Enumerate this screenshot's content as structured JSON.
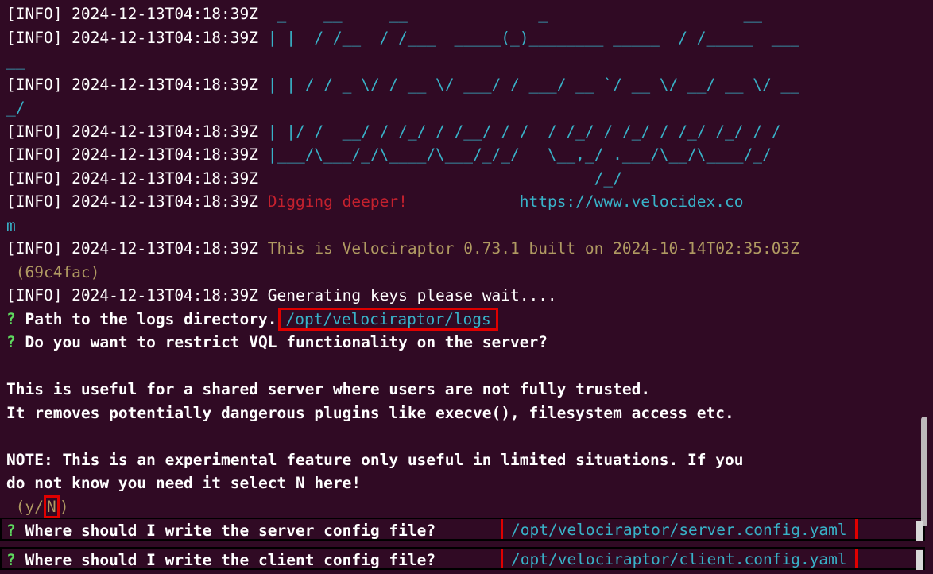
{
  "log_lines": [
    {
      "prefix": "[INFO] 2024-12-13T04:18:39Z",
      "ascii": " _    __     __              _                     __"
    },
    {
      "prefix": "[INFO] 2024-12-13T04:18:39Z",
      "ascii": "| |  / /__  / /___  _____(_)________ _____  / /_____  ___"
    },
    {
      "prefix": "",
      "ascii": "__"
    },
    {
      "prefix": "[INFO] 2024-12-13T04:18:39Z",
      "ascii": "| | / / _ \\/ / __ \\/ ___/ / ___/ __ `/ __ \\/ __/ __ \\/ __"
    },
    {
      "prefix": "",
      "ascii": "_/"
    },
    {
      "prefix": "[INFO] 2024-12-13T04:18:39Z",
      "ascii": "| |/ /  __/ / /_/ / /__/ / /  / /_/ / /_/ / /_/ /_/ / /"
    },
    {
      "prefix": "[INFO] 2024-12-13T04:18:39Z",
      "ascii": "|___/\\___/_/\\____/\\___/_/_/   \\__,_/ .___/\\__/\\____/_/"
    },
    {
      "prefix": "[INFO] 2024-12-13T04:18:39Z",
      "ascii": "                                   /_/"
    }
  ],
  "digging": {
    "prefix": "[INFO] 2024-12-13T04:18:39Z",
    "text": "Digging deeper!",
    "url": "https://www.velocidex.co",
    "url_wrap": "m"
  },
  "build": {
    "prefix": "[INFO] 2024-12-13T04:18:39Z",
    "text": "This is Velociraptor 0.73.1 built on 2024-10-14T02:35:03Z",
    "wrap": " (69c4fac)"
  },
  "keys": {
    "prefix": "[INFO] 2024-12-13T04:18:39Z",
    "text": "Generating keys please wait...."
  },
  "logs_prompt": {
    "mark": "?",
    "question": "Path to the logs directory.",
    "answer": "/opt/velociraptor/logs"
  },
  "vql_prompt": {
    "mark": "?",
    "question": "Do you want to restrict VQL functionality on the server?"
  },
  "vql_help": [
    "This is useful for a shared server where users are not fully trusted.",
    "It removes potentially dangerous plugins like execve(), filesystem access etc."
  ],
  "vql_note": [
    "NOTE: This is an experimental feature only useful in limited situations. If you",
    "do not know you need it select N here!"
  ],
  "yn": {
    "prefix": " (y/",
    "selected": "N",
    "suffix": ")"
  },
  "server_prompt": {
    "mark": "?",
    "question": "Where should I write the server config file?",
    "answer": "/opt/velociraptor/server.config.yaml"
  },
  "client_prompt": {
    "mark": "?",
    "question": "Where should I write the client config file?",
    "answer": "/opt/velociraptor/client.config.yaml"
  },
  "colors": {
    "background": "#300a24",
    "ascii": "#38b2c8",
    "digging": "#c4212e",
    "build": "#b09a62",
    "prompt_mark": "#5fd75f",
    "highlight": "#e00000"
  }
}
